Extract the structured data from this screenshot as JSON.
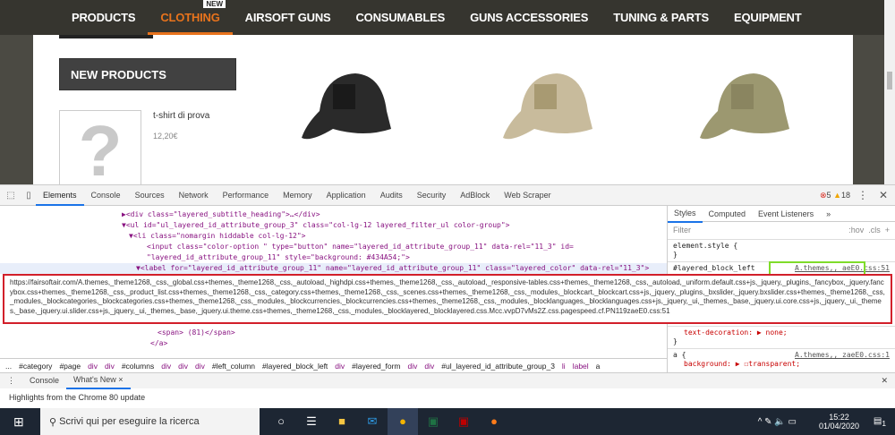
{
  "site": {
    "nav": [
      {
        "label": "PRODUCTS"
      },
      {
        "label": "CLOTHING",
        "active": true,
        "badge": "NEW"
      },
      {
        "label": "AIRSOFT GUNS"
      },
      {
        "label": "CONSUMABLES"
      },
      {
        "label": "GUNS ACCESSORIES"
      },
      {
        "label": "TUNING & PARTS"
      },
      {
        "label": "EQUIPMENT"
      }
    ],
    "new_products_title": "NEW PRODUCTS",
    "product": {
      "name": "t-shirt di prova",
      "price": "12,20€",
      "placeholder": "?"
    },
    "caps": [
      {
        "color": "#2a2a2a"
      },
      {
        "color": "#c8bb9c"
      },
      {
        "color": "#9c9870"
      }
    ]
  },
  "devtools": {
    "tabs": [
      "Elements",
      "Console",
      "Sources",
      "Network",
      "Performance",
      "Memory",
      "Application",
      "Audits",
      "Security",
      "AdBlock",
      "Web Scraper"
    ],
    "errors": "5",
    "warnings": "18",
    "code": [
      "▶<div class=\"layered_subtitle_heading\">…</div>",
      "▼<ul id=\"ul_layered_id_attribute_group_3\" class=\"col-lg-12 layered_filter_ul color-group\">",
      "▼<li class=\"nomargin hiddable col-lg-12\">",
      "<input class=\"color-option  \" type=\"button\" name=\"layered_id_attribute_group_11\" data-rel=\"11_3\" id=",
      "\"layered_id_attribute_group_11\" style=\"background: #434A54;\">",
      "▼<label for=\"layered_id_attribute_group_11\" name=\"layered_id_attribute_group_11\" class=\"layered_color\" data-rel=\"11_3\">",
      "<span> (81)</span>",
      "</a>"
    ],
    "styles": {
      "tabs": [
        "Styles",
        "Computed",
        "Event Listeners",
        "»"
      ],
      "filter": "Filter",
      "hov": ":hov",
      ".cls": ".cls",
      "rules": [
        {
          "sel": "element.style {",
          "close": "}"
        },
        {
          "sel": "#layered_block_left",
          "src": "A.themes,,_aeE0.css:51"
        },
        {
          "prop": "text-decoration: ▶ none;",
          "close": "}"
        },
        {
          "sel": "a {",
          "src": "A.themes,,_zaeE0.css:1",
          "prop": "background: ▶ ☐transparent;"
        }
      ]
    },
    "tooltip": "https://fairsoftair.com/A.themes,_theme1268,_css,_global.css+themes,_theme1268,_css,_autoload,_highdpi.css+themes,_theme1268,_css,_autoload,_responsive-tables.css+themes,_theme1268,_css,_autoload,_uniform.default.css+js,_jquery,_plugins,_fancybox,_jquery.fancybox.css+themes,_theme1268,_css,_product_list.css+themes,_theme1268,_css,_category.css+themes,_theme1268,_css,_scenes.css+themes,_theme1268,_css,_modules,_blockcart,_blockcart.css+js,_jquery,_plugins,_bxslider,_jquery.bxslider.css+themes,_theme1268,_css,_modules,_blockcategories,_blockcategories.css+themes,_theme1268,_css,_modules,_blockcurrencies,_blockcurrencies.css+themes,_theme1268,_css,_modules,_blocklanguages,_blocklanguages.css+js,_jquery,_ui,_themes,_base,_jquery.ui.core.css+js,_jquery,_ui,_themes,_base,_jquery.ui.slider.css+js,_jquery,_ui,_themes,_base,_jquery.ui.theme.css+themes,_theme1268,_css,_modules,_blocklayered,_blocklayered.css.Mcc.vvpD7vMs2Z.css.pagespeed.cf.PN119zaeE0.css:51",
    "breadcrumbs": [
      "...",
      "#category",
      "#page",
      "div",
      "div",
      "#columns",
      "div",
      "div",
      "div",
      "#left_column",
      "#layered_block_left",
      "div",
      "#layered_form",
      "div",
      "div",
      "#ul_layered_id_attribute_group_3",
      "li",
      "label",
      "a"
    ],
    "drawer": {
      "tabs": [
        "Console",
        "What's New ×"
      ],
      "content": "Highlights from the Chrome 80 update"
    }
  },
  "taskbar": {
    "search_placeholder": "Scrivi qui per eseguire la ricerca",
    "time": "15:22",
    "date": "01/04/2020",
    "notifications": "1"
  }
}
